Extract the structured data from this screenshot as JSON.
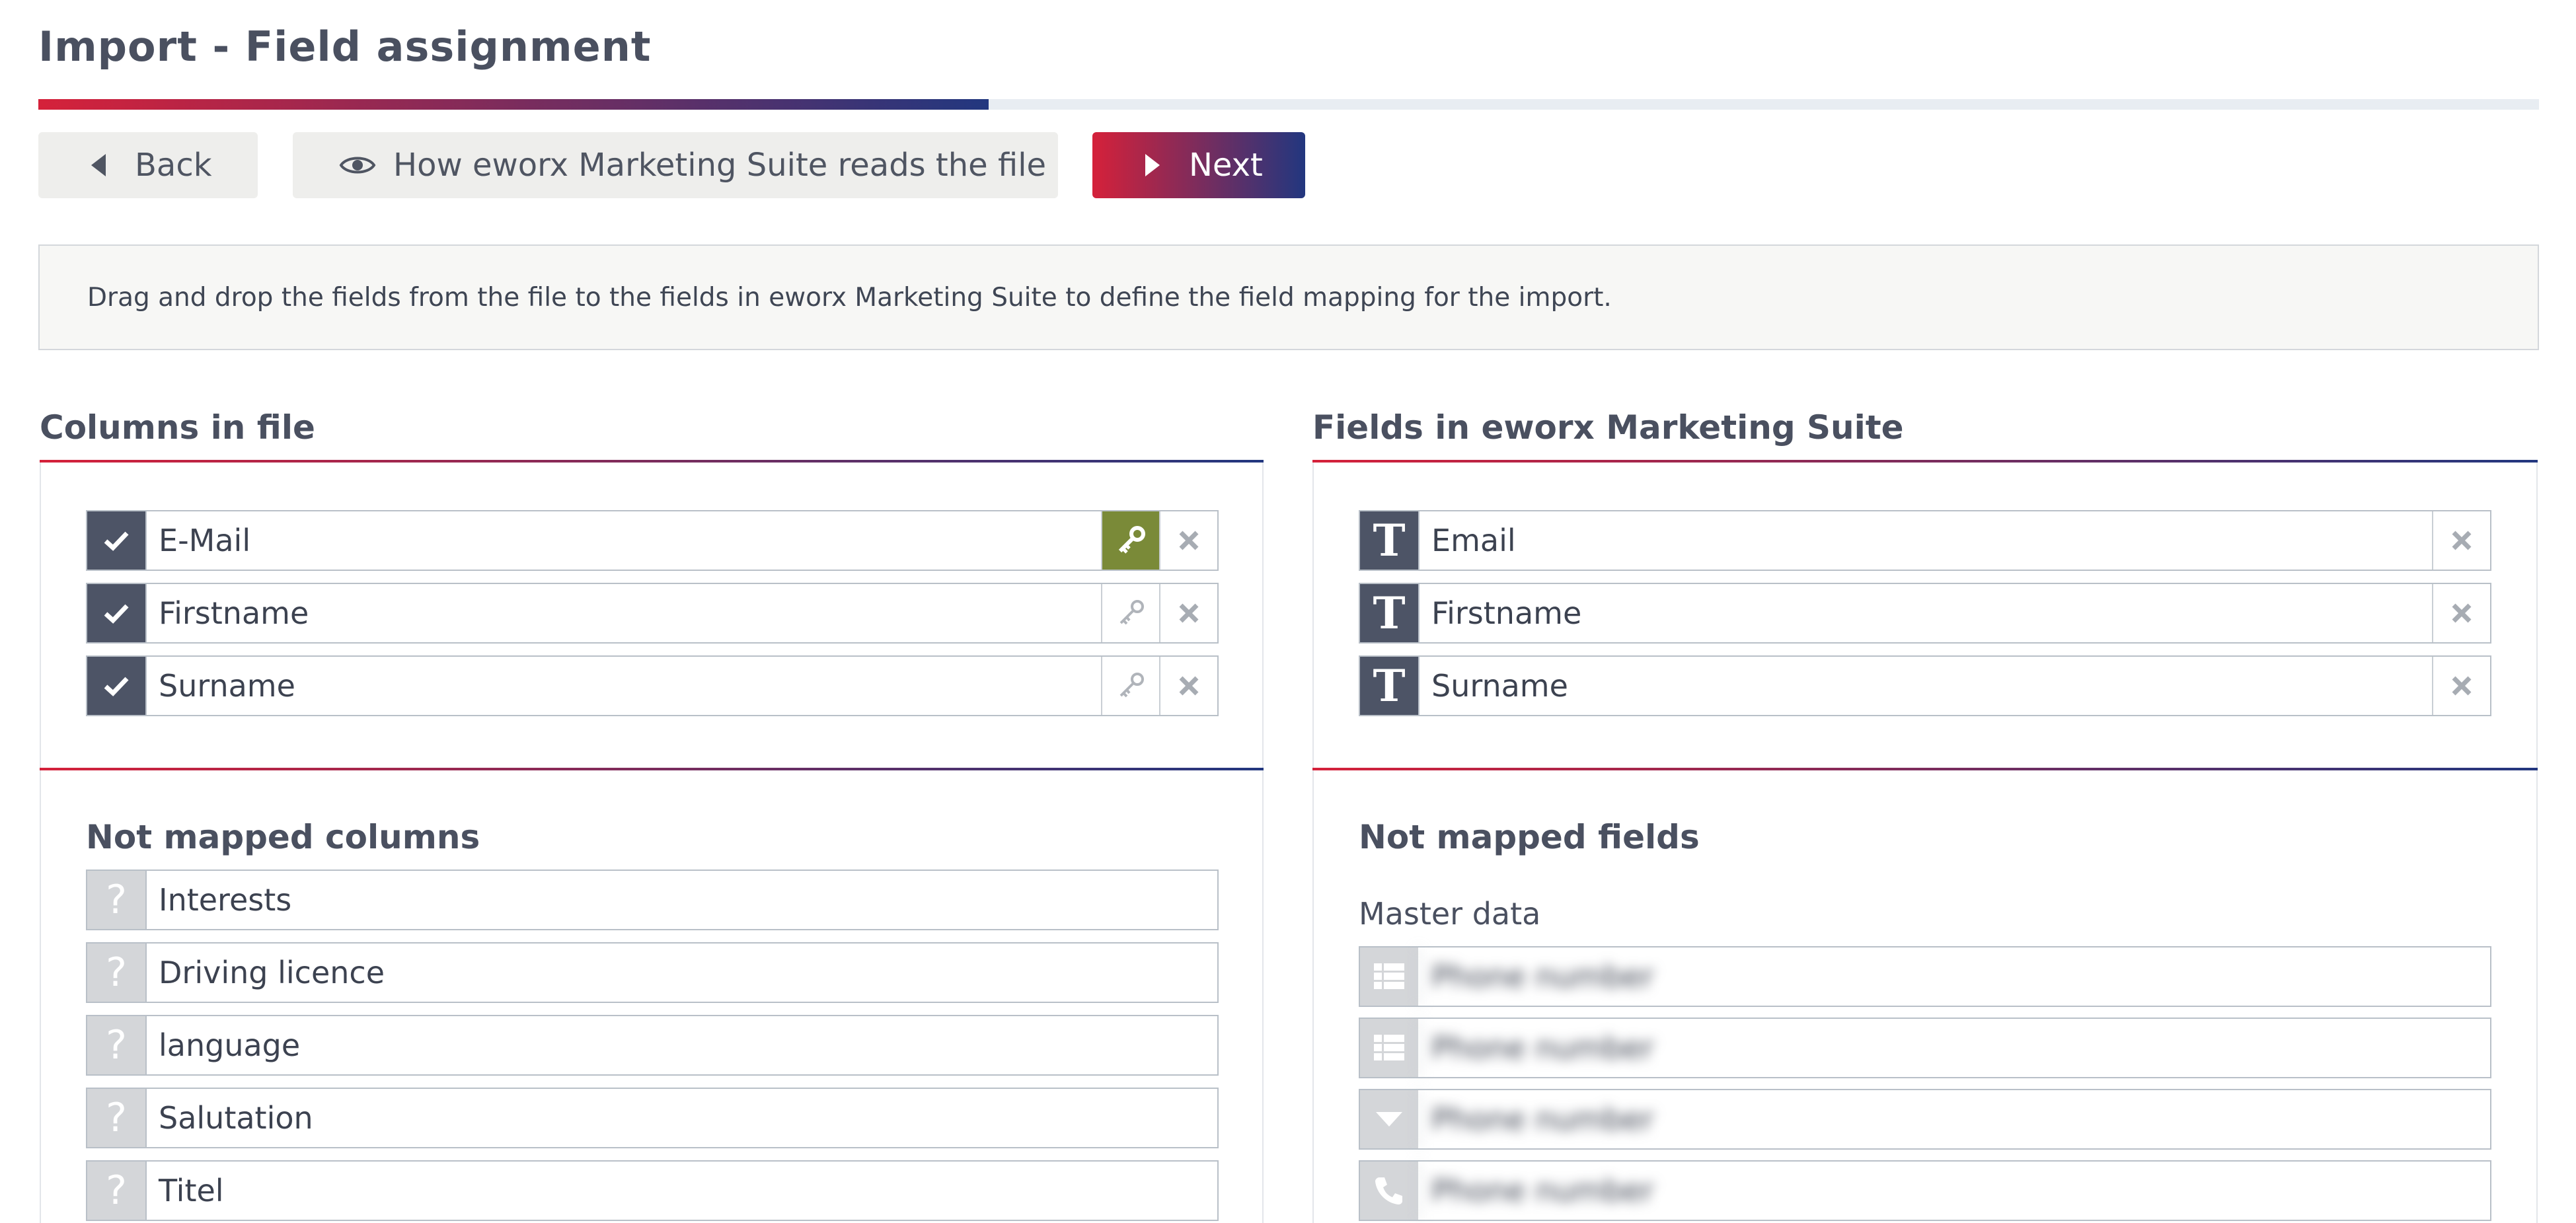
{
  "header": {
    "title": "Import - Field assignment",
    "progress_fraction": 0.38
  },
  "toolbar": {
    "back_label": "Back",
    "preview_label": "How eworx Marketing Suite reads the file",
    "next_label": "Next"
  },
  "info": {
    "text": "Drag and drop the fields from the file to the fields in eworx Marketing Suite to define the field mapping for the import."
  },
  "colors": {
    "accent_start": "#d5213a",
    "accent_end": "#22377f",
    "key_active": "#7a8a38",
    "row_icon_bg": "#4d5466"
  },
  "file_columns": {
    "title": "Columns in file",
    "mapped": [
      {
        "label": "E-Mail",
        "icon": "check-icon",
        "is_key": true
      },
      {
        "label": "Firstname",
        "icon": "check-icon",
        "is_key": false
      },
      {
        "label": "Surname",
        "icon": "check-icon",
        "is_key": false
      }
    ],
    "not_mapped_title": "Not mapped columns",
    "not_mapped": [
      {
        "label": "Interests",
        "icon": "question-icon"
      },
      {
        "label": "Driving licence",
        "icon": "question-icon"
      },
      {
        "label": "language",
        "icon": "question-icon"
      },
      {
        "label": "Salutation",
        "icon": "question-icon"
      },
      {
        "label": "Titel",
        "icon": "question-icon"
      }
    ]
  },
  "suite_fields": {
    "title": "Fields in eworx Marketing Suite",
    "mapped": [
      {
        "label": "Email",
        "icon": "text-type-icon"
      },
      {
        "label": "Firstname",
        "icon": "text-type-icon"
      },
      {
        "label": "Surname",
        "icon": "text-type-icon"
      }
    ],
    "not_mapped_title": "Not mapped fields",
    "group_label": "Master data",
    "not_mapped": [
      {
        "label": "Phone number",
        "icon": "list-icon"
      },
      {
        "label": "Phone number",
        "icon": "list-icon"
      },
      {
        "label": "Phone number",
        "icon": "dropdown-icon"
      },
      {
        "label": "Phone number",
        "icon": "phone-icon"
      }
    ]
  }
}
